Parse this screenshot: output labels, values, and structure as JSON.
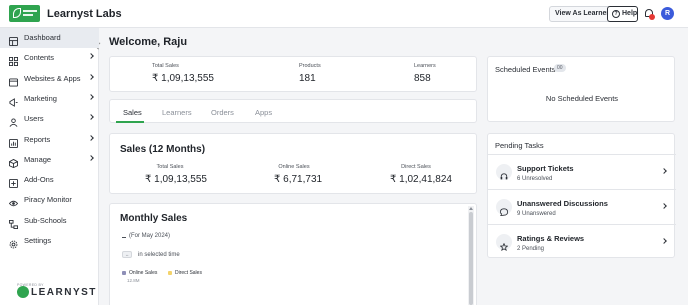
{
  "header": {
    "org_name": "Learnyst Labs",
    "view_as_learner": "View As Learner",
    "help": "Help",
    "help_icon": "?",
    "avatar_initial": "R",
    "brand_color": "#2fa44f",
    "notification_color": "#e53935"
  },
  "sidebar": {
    "items": [
      {
        "label": "Dashboard",
        "icon": "dashboard-icon",
        "active": true,
        "has_children": false
      },
      {
        "label": "Contents",
        "icon": "grid-icon",
        "has_children": true
      },
      {
        "label": "Websites & Apps",
        "icon": "browser-icon",
        "has_children": true
      },
      {
        "label": "Marketing",
        "icon": "megaphone-icon",
        "has_children": true
      },
      {
        "label": "Users",
        "icon": "user-icon",
        "has_children": true
      },
      {
        "label": "Reports",
        "icon": "chart-icon",
        "has_children": true
      },
      {
        "label": "Manage",
        "icon": "cube-icon",
        "has_children": true
      },
      {
        "label": "Add-Ons",
        "icon": "plus-square-icon",
        "has_children": false
      },
      {
        "label": "Piracy Monitor",
        "icon": "eye-icon",
        "has_children": false
      },
      {
        "label": "Sub-Schools",
        "icon": "branch-icon",
        "has_children": false
      },
      {
        "label": "Settings",
        "icon": "gear-icon",
        "has_children": false
      }
    ],
    "powered_by": "POWERED BY",
    "brand": "LEARNYST"
  },
  "welcome": "Welcome, Raju",
  "summary": {
    "total_sales_label": "Total Sales",
    "total_sales_value": "₹ 1,09,13,555",
    "products_label": "Products",
    "products_value": "181",
    "learners_label": "Learners",
    "learners_value": "858"
  },
  "tabs": [
    "Sales",
    "Learners",
    "Orders",
    "Apps"
  ],
  "sales": {
    "title": "Sales (12 Months)",
    "total_label": "Total Sales",
    "total_value": "₹ 1,09,13,555",
    "online_label": "Online Sales",
    "online_value": "₹ 6,71,731",
    "direct_label": "Direct Sales",
    "direct_value": "₹ 1,02,41,824"
  },
  "monthly": {
    "title": "Monthly Sales",
    "period": "(For May 2024)",
    "selected_icon": "↔",
    "selected_text": "in selected time",
    "legend": [
      {
        "name": "Online Sales",
        "color": "#8e8fb7"
      },
      {
        "name": "Direct Sales",
        "color": "#f3d36b"
      }
    ],
    "y_tick": "12.8M"
  },
  "scheduled": {
    "title": "Scheduled Events",
    "badge": "00",
    "empty": "No Scheduled Events"
  },
  "pending": {
    "title": "Pending Tasks",
    "tasks": [
      {
        "name": "Support Tickets",
        "sub": "6 Unresolved",
        "icon": "headset-icon"
      },
      {
        "name": "Unanswered Discussions",
        "sub": "9 Unanswered",
        "icon": "chat-bubble-icon"
      },
      {
        "name": "Ratings & Reviews",
        "sub": "2 Pending",
        "icon": "star-icon"
      }
    ]
  }
}
